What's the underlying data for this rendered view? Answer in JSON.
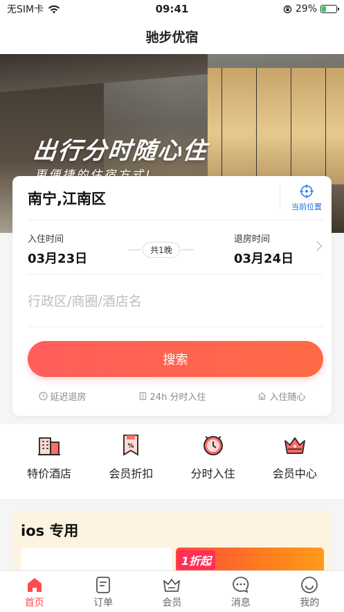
{
  "status_bar": {
    "carrier": "无SIM卡",
    "time": "09:41",
    "battery": "29%"
  },
  "nav": {
    "title": "驰步优宿"
  },
  "hero": {
    "title": "出行分时随心住",
    "subtitle": "更便捷的住宿方式!"
  },
  "search": {
    "location": "南宁,江南区",
    "locate_label": "当前位置",
    "checkin_label": "入住时间",
    "checkin_value": "03月23日",
    "nights": "共1晚",
    "checkout_label": "退房时间",
    "checkout_value": "03月24日",
    "keyword_placeholder": "行政区/商圈/酒店名",
    "button_label": "搜索",
    "features": [
      "延迟退房",
      "24h 分时入住",
      "入住随心"
    ]
  },
  "quick_entries": [
    {
      "label": "特价酒店",
      "icon": "hotel-icon"
    },
    {
      "label": "会员折扣",
      "icon": "discount-icon"
    },
    {
      "label": "分时入住",
      "icon": "clock-icon"
    },
    {
      "label": "会员中心",
      "icon": "crown-icon"
    }
  ],
  "ios_section": {
    "title": "ios 专用",
    "badge": "1折起"
  },
  "tabbar": [
    {
      "label": "首页",
      "icon": "home-icon",
      "active": true
    },
    {
      "label": "订单",
      "icon": "order-icon",
      "active": false
    },
    {
      "label": "会员",
      "icon": "member-icon",
      "active": false
    },
    {
      "label": "消息",
      "icon": "message-icon",
      "active": false
    },
    {
      "label": "我的",
      "icon": "profile-icon",
      "active": false
    }
  ],
  "colors": {
    "accent": "#ff4b4b",
    "button_start": "#ff5e5b",
    "button_end": "#ff6a45",
    "locate": "#1a73e8",
    "ios_bg": "#fdf3e1"
  }
}
